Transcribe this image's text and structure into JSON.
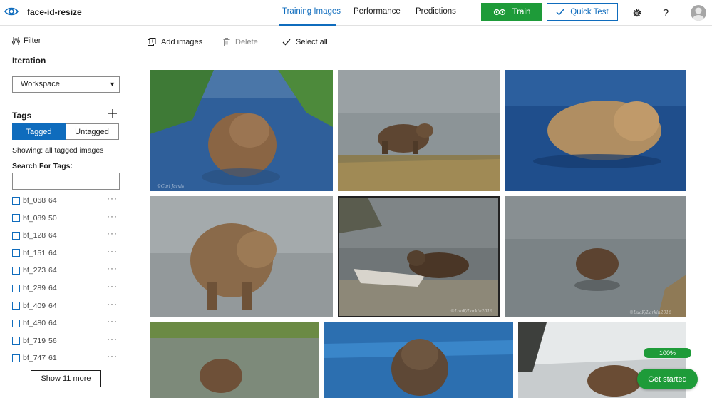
{
  "app": {
    "project_name": "face-id-resize",
    "brand_icon": "eye-icon"
  },
  "nav": {
    "tabs": [
      {
        "label": "Training Images",
        "active": true
      },
      {
        "label": "Performance",
        "active": false
      },
      {
        "label": "Predictions",
        "active": false
      }
    ],
    "train_label": "Train",
    "quick_test_label": "Quick Test",
    "settings_icon": "gear-icon",
    "help_icon": "question-icon"
  },
  "sidebar": {
    "filter_label": "Filter",
    "iteration_heading": "Iteration",
    "iteration_selected": "Workspace",
    "tags_heading": "Tags",
    "toggle": {
      "tagged": "Tagged",
      "untagged": "Untagged",
      "active": "tagged"
    },
    "showing_text": "Showing: all tagged images",
    "search_label": "Search For Tags:",
    "search_value": "",
    "tags": [
      {
        "name": "bf_068",
        "count": "64"
      },
      {
        "name": "bf_089",
        "count": "50"
      },
      {
        "name": "bf_128",
        "count": "64"
      },
      {
        "name": "bf_151",
        "count": "64"
      },
      {
        "name": "bf_273",
        "count": "64"
      },
      {
        "name": "bf_289",
        "count": "64"
      },
      {
        "name": "bf_409",
        "count": "64"
      },
      {
        "name": "bf_480",
        "count": "64"
      },
      {
        "name": "bf_719",
        "count": "56"
      },
      {
        "name": "bf_747",
        "count": "61"
      }
    ],
    "more_glyph": "···",
    "show_more_label": "Show 11 more"
  },
  "toolbar": {
    "add_images": "Add images",
    "delete": "Delete",
    "select_all": "Select all"
  },
  "images": [
    {
      "alt": "bear-photo-1",
      "watermark": "©Carl Jarvis"
    },
    {
      "alt": "bear-photo-2",
      "watermark": ""
    },
    {
      "alt": "bear-photo-3",
      "watermark": ""
    },
    {
      "alt": "bear-photo-4",
      "watermark": ""
    },
    {
      "alt": "bear-photo-5",
      "watermark": "©LuaK/Larkin2016"
    },
    {
      "alt": "bear-photo-6",
      "watermark": "©LuaK/Larkin2016"
    },
    {
      "alt": "bear-photo-7",
      "watermark": ""
    },
    {
      "alt": "bear-photo-8",
      "watermark": ""
    },
    {
      "alt": "bear-photo-9",
      "watermark": ""
    }
  ],
  "floating": {
    "progress_label": "100%",
    "progress_value": 1.0,
    "get_started_label": "Get started"
  },
  "colors": {
    "accent": "#0f6cbd",
    "train_green": "#1e9b39"
  }
}
